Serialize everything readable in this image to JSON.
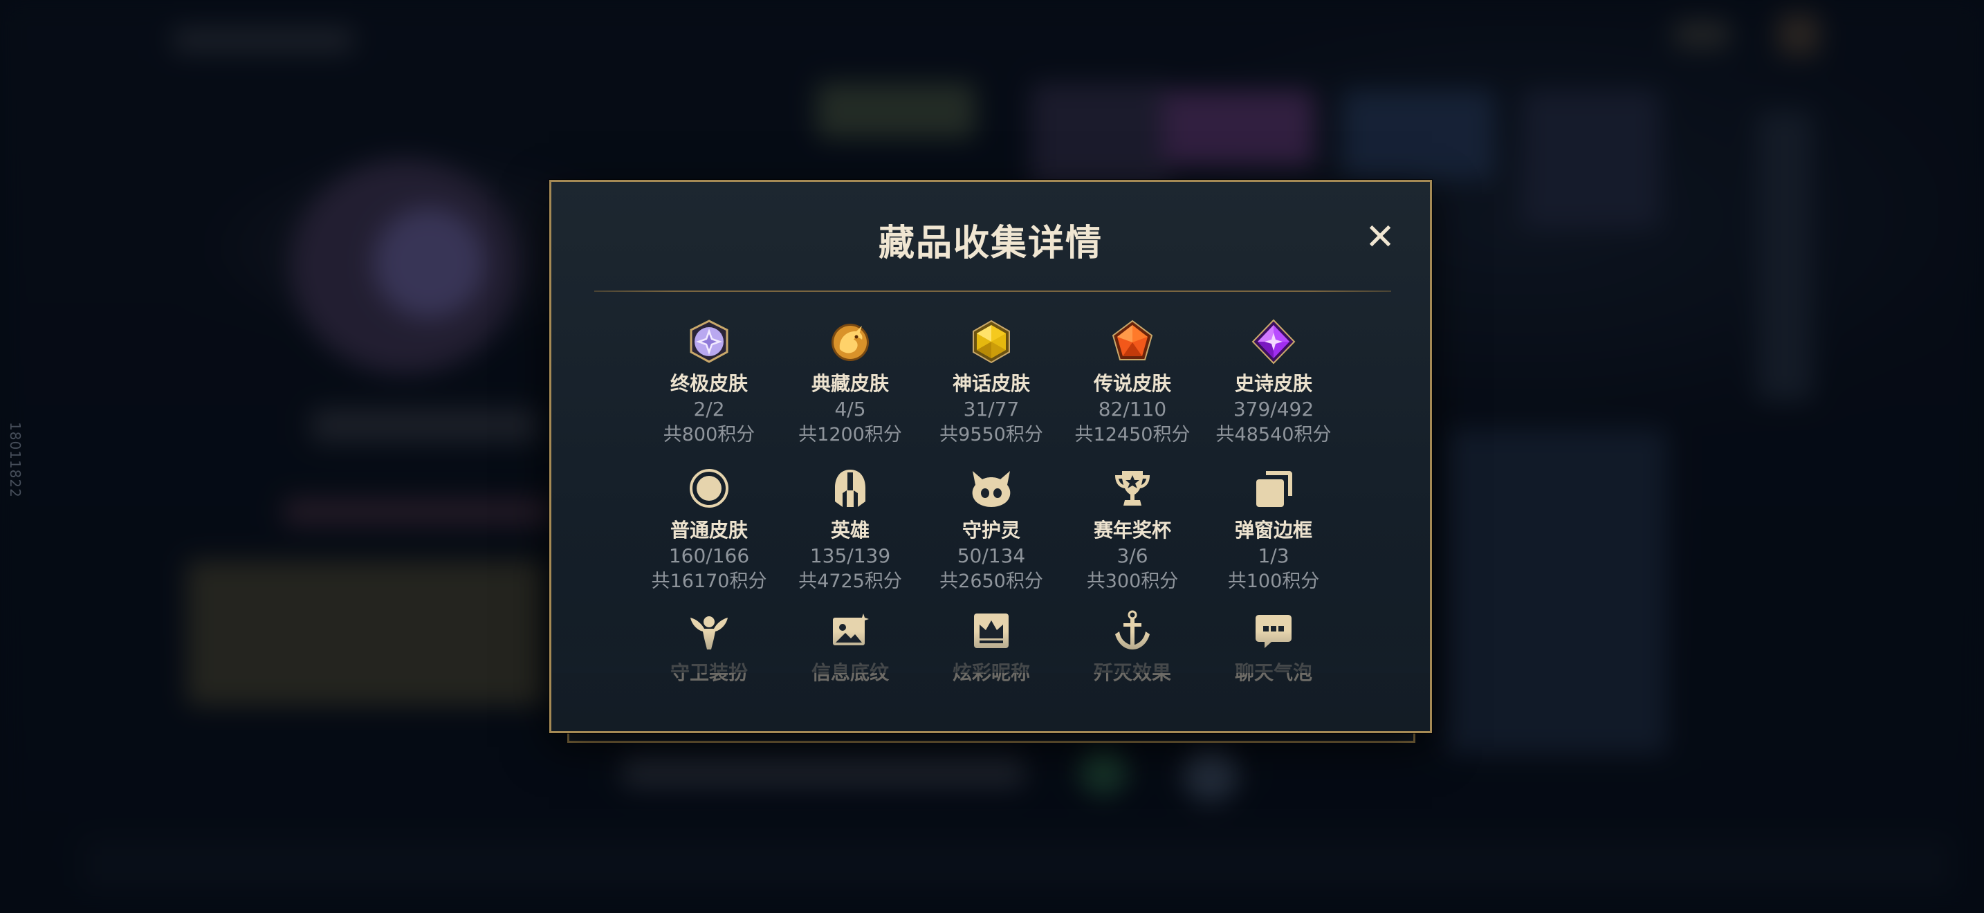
{
  "side_id": "18011822",
  "modal": {
    "title": "藏品收集详情",
    "close_label": "✕"
  },
  "categories": [
    {
      "name": "终极皮肤",
      "count": "2/2",
      "points": "共800积分",
      "icon": "ultimate-skin-gem-icon",
      "color": "#c8b6ff"
    },
    {
      "name": "典藏皮肤",
      "count": "4/5",
      "points": "共1200积分",
      "icon": "prestige-dragon-icon",
      "color": "#e3a43a"
    },
    {
      "name": "神话皮肤",
      "count": "31/77",
      "points": "共9550积分",
      "icon": "mythic-gem-icon",
      "color": "#f2c21a"
    },
    {
      "name": "传说皮肤",
      "count": "82/110",
      "points": "共12450积分",
      "icon": "legendary-gem-icon",
      "color": "#ff6a1a"
    },
    {
      "name": "史诗皮肤",
      "count": "379/492",
      "points": "共48540积分",
      "icon": "epic-gem-icon",
      "color": "#b23dff"
    },
    {
      "name": "普通皮肤",
      "count": "160/166",
      "points": "共16170积分",
      "icon": "standard-skin-circle-icon",
      "color": "#e8d6b0"
    },
    {
      "name": "英雄",
      "count": "135/139",
      "points": "共4725积分",
      "icon": "champion-helmet-icon",
      "color": "#e8d6b0"
    },
    {
      "name": "守护灵",
      "count": "50/134",
      "points": "共2650积分",
      "icon": "little-legend-pet-icon",
      "color": "#e8d6b0"
    },
    {
      "name": "赛年奖杯",
      "count": "3/6",
      "points": "共300积分",
      "icon": "trophy-icon",
      "color": "#e8d6b0"
    },
    {
      "name": "弹窗边框",
      "count": "1/3",
      "points": "共100积分",
      "icon": "frame-cards-icon",
      "color": "#e8d6b0"
    },
    {
      "name": "守卫装扮",
      "icon": "ward-skin-icon",
      "color": "#e8d6b0"
    },
    {
      "name": "信息底纹",
      "icon": "banner-image-icon",
      "color": "#e8d6b0"
    },
    {
      "name": "炫彩昵称",
      "icon": "crown-nameplate-icon",
      "color": "#e8d6b0"
    },
    {
      "name": "歼灭效果",
      "icon": "anchor-finisher-icon",
      "color": "#e8d6b0"
    },
    {
      "name": "聊天气泡",
      "icon": "chat-bubble-icon",
      "color": "#e8d6b0"
    }
  ],
  "colors": {
    "border_gold": "#a58a55",
    "title_text": "#f0e6d2",
    "muted_text": "#8f959c"
  }
}
